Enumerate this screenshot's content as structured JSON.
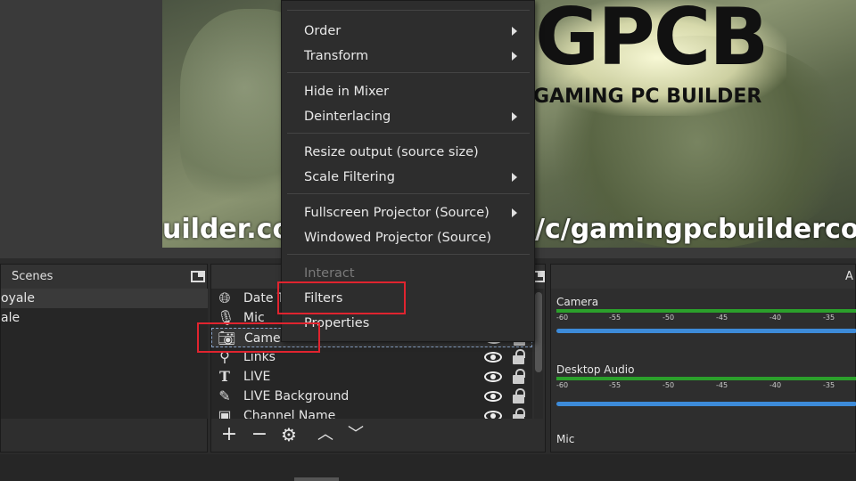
{
  "preview": {
    "logo_main": "GPCB",
    "logo_sub": "GAMING PC BUILDER",
    "url_left": "uilder.co",
    "url_right": "/c/gamingpcbuildercom"
  },
  "scenes": {
    "title": "Scenes",
    "items": [
      "oyale",
      "ale"
    ]
  },
  "sources": {
    "items": [
      {
        "label": "Date T",
        "icon": "globe-icon"
      },
      {
        "label": "Mic",
        "icon": "microphone-icon"
      },
      {
        "label": "Camera",
        "icon": "camera-icon"
      },
      {
        "label": "Links",
        "icon": "links-icon"
      },
      {
        "label": "LIVE",
        "icon": "text-icon"
      },
      {
        "label": "LIVE Background",
        "icon": "brush-icon"
      },
      {
        "label": "Channel Name",
        "icon": "image-icon"
      }
    ],
    "toolbar": [
      "add-icon",
      "remove-icon",
      "gear-icon",
      "move-up-icon",
      "move-down-icon"
    ]
  },
  "mixer": {
    "title": "A",
    "channels": [
      {
        "name": "Camera",
        "ticks": [
          "-60",
          "-55",
          "-50",
          "-45",
          "-40",
          "-35"
        ]
      },
      {
        "name": "Desktop Audio",
        "ticks": [
          "-60",
          "-55",
          "-50",
          "-45",
          "-40",
          "-35"
        ]
      },
      {
        "name": "Mic",
        "ticks": []
      }
    ],
    "meter_color": "#2ba02b",
    "slider_color": "#3d8bd9"
  },
  "context_menu": {
    "order": "Order",
    "transform": "Transform",
    "hide_in_mixer": "Hide in Mixer",
    "deinterlacing": "Deinterlacing",
    "resize_output": "Resize output (source size)",
    "scale_filtering": "Scale Filtering",
    "fullscreen_projector": "Fullscreen Projector (Source)",
    "windowed_projector": "Windowed Projector (Source)",
    "interact": "Interact",
    "filters": "Filters",
    "properties": "Properties"
  },
  "highlight_color": "#e0242f"
}
